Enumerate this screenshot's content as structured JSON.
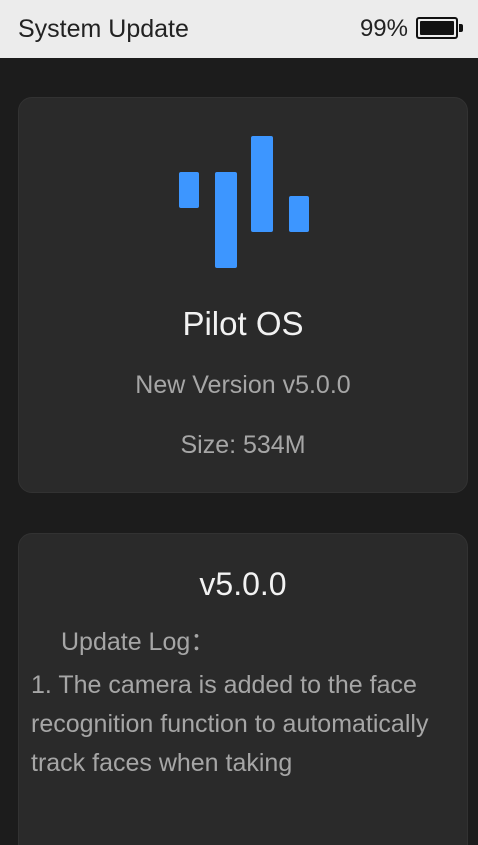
{
  "status_bar": {
    "title": "System Update",
    "battery_percent": "99%",
    "battery_level": 0.99
  },
  "os_card": {
    "logo_icon": "bars-logo-icon",
    "name": "Pilot OS",
    "version": "New Version v5.0.0",
    "size": "Size: 534M"
  },
  "log_card": {
    "version": "v5.0.0",
    "heading": "Update Log：",
    "body": "1. The camera is added to the face recognition function to automatically track faces when taking"
  },
  "colors": {
    "background": "#1c1c1c",
    "card": "#2a2a2a",
    "status_bar": "#ececec",
    "accent": "#3d96ff",
    "primary_text": "#f2f2f2",
    "secondary_text": "#a6a6a6"
  }
}
